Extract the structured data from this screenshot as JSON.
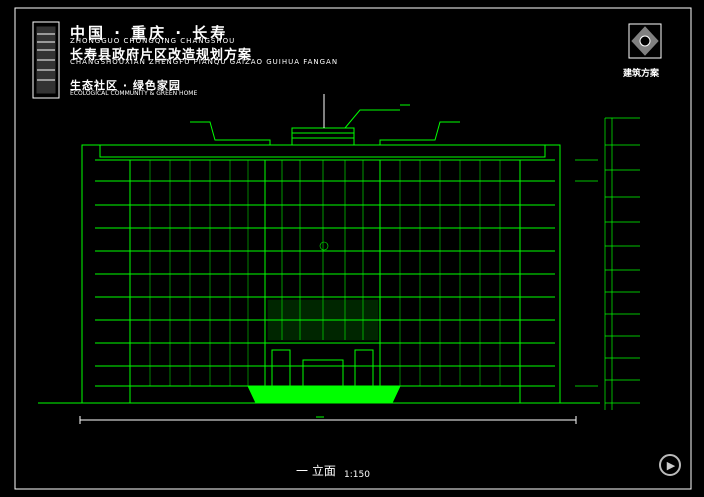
{
  "header": {
    "title_cn_1": "中国 · 重庆 · 长寿",
    "title_pinyin_1": "ZHONGGUO CHONGQING CHANGSHOU",
    "title_cn_2": "长寿县政府片区改造规划方案",
    "title_pinyin_2": "CHANGSHOUXIAN ZHENGFU PIANQU GAIZAO GUIHUA FANGAN",
    "subtitle_cn": "生态社区 · 绿色家园",
    "subtitle_en": "ECOLOGICAL COMMUNITY & GREEN HOME"
  },
  "logo": {
    "label": "建筑方案"
  },
  "drawing": {
    "caption": "一 立面",
    "scale": "1:150",
    "colors": {
      "line": "#00ff00",
      "frame": "#ffffff",
      "accent": "#00ff66"
    }
  },
  "controls": {
    "play_icon": "play-icon"
  }
}
